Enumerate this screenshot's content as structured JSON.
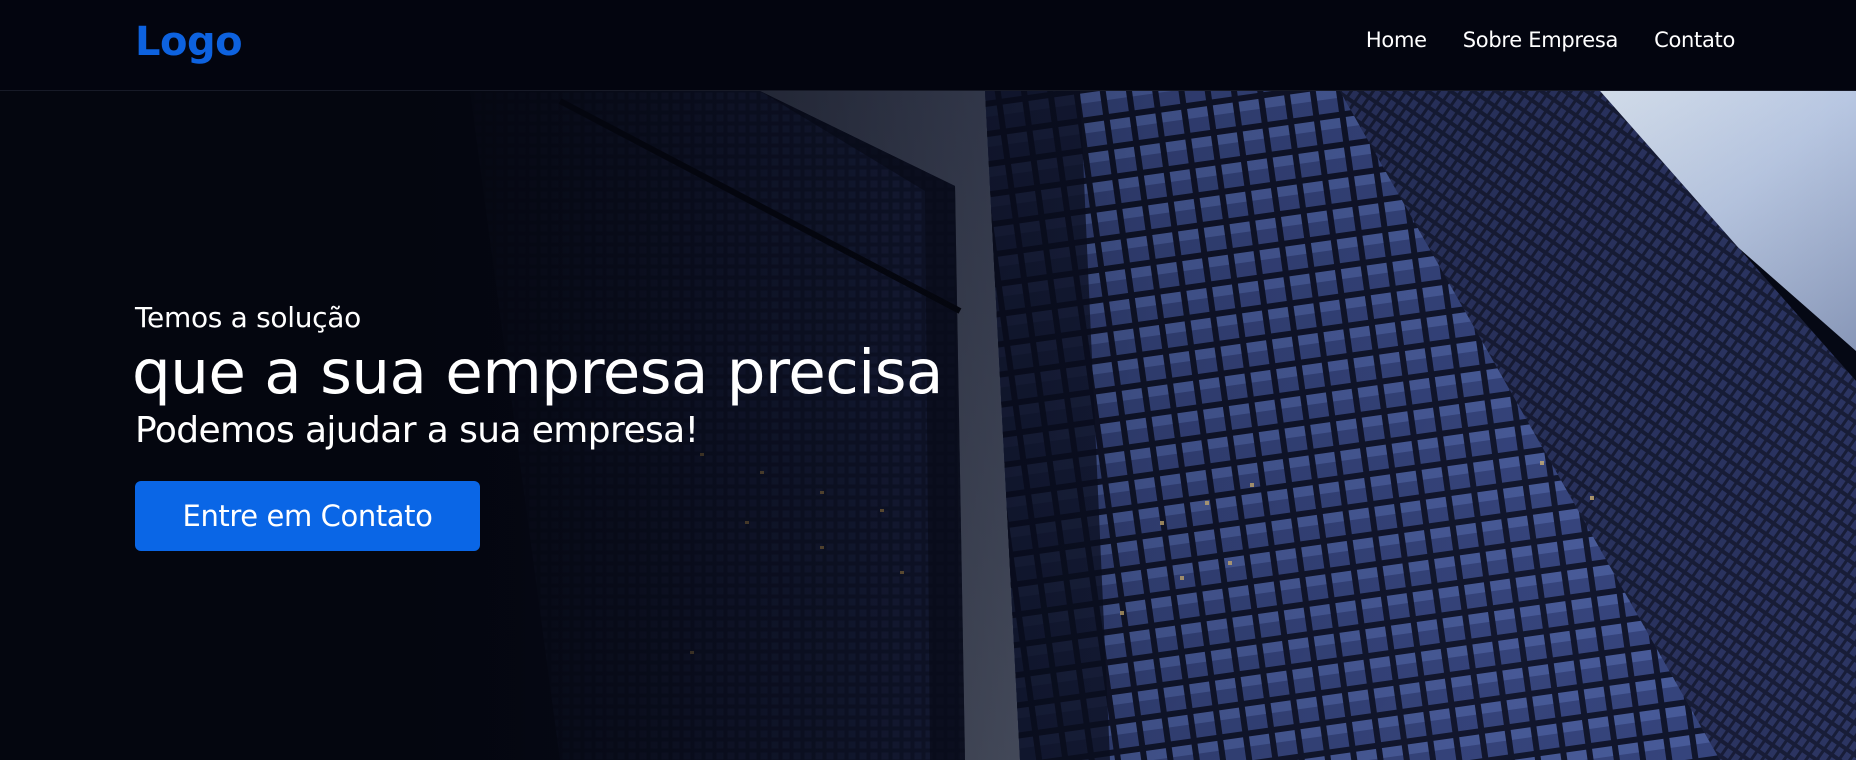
{
  "header": {
    "logo": "Logo",
    "nav": [
      {
        "label": "Home"
      },
      {
        "label": "Sobre Empresa"
      },
      {
        "label": "Contato"
      }
    ]
  },
  "hero": {
    "subtitle": "Temos a solução",
    "title": "que a sua empresa precisa",
    "tagline": "Podemos ajudar a sua empresa!",
    "cta_label": "Entre em Contato",
    "background": "skyscrapers-photo"
  },
  "colors": {
    "brand": "#0d62df",
    "button": "#0a66e6",
    "background": "#04060f"
  }
}
